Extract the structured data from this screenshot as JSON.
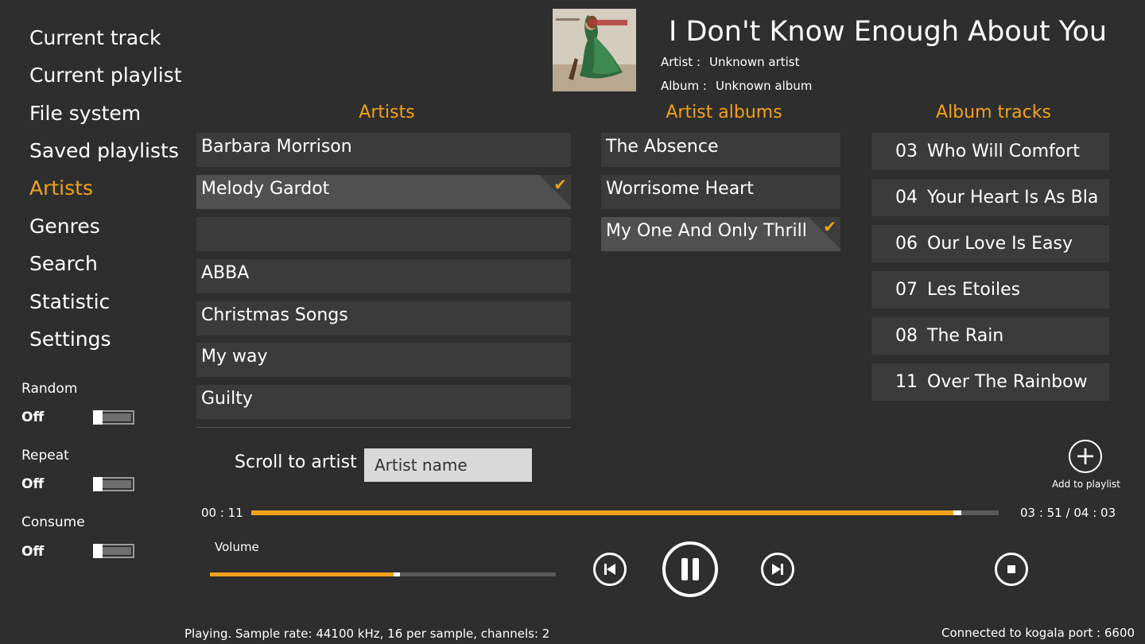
{
  "nav": {
    "items": [
      {
        "label": "Current track"
      },
      {
        "label": "Current playlist"
      },
      {
        "label": "File system"
      },
      {
        "label": "Saved playlists"
      },
      {
        "label": "Artists",
        "active": true
      },
      {
        "label": "Genres"
      },
      {
        "label": "Search"
      },
      {
        "label": "Statistic"
      },
      {
        "label": "Settings"
      }
    ]
  },
  "options": {
    "random": {
      "label": "Random",
      "value": "Off"
    },
    "repeat": {
      "label": "Repeat",
      "value": "Off"
    },
    "consume": {
      "label": "Consume",
      "value": "Off"
    }
  },
  "now_playing": {
    "title": "I Don't Know Enough About You",
    "artist_label": "Artist :",
    "artist_value": "Unknown artist",
    "album_label": "Album :",
    "album_value": "Unknown album"
  },
  "columns": {
    "artists_header": "Artists",
    "albums_header": "Artist albums",
    "tracks_header": "Album tracks"
  },
  "artists": [
    {
      "name": "Barbara Morrison"
    },
    {
      "name": "Melody Gardot",
      "selected": true
    },
    {
      "name": ""
    },
    {
      "name": "ABBA"
    },
    {
      "name": "Christmas Songs"
    },
    {
      "name": "My way"
    },
    {
      "name": "Guilty"
    }
  ],
  "albums": [
    {
      "name": "The Absence"
    },
    {
      "name": "Worrisome Heart"
    },
    {
      "name": "My One And Only Thrill",
      "selected": true
    }
  ],
  "tracks": [
    {
      "num": "03",
      "title": "Who Will Comfort"
    },
    {
      "num": "04",
      "title": "Your Heart Is As Bla"
    },
    {
      "num": "06",
      "title": "Our Love Is Easy"
    },
    {
      "num": "07",
      "title": "Les Etoiles"
    },
    {
      "num": "08",
      "title": "The Rain"
    },
    {
      "num": "11",
      "title": "Over The Rainbow"
    }
  ],
  "search": {
    "label": "Scroll to artist",
    "placeholder": "Artist name"
  },
  "add_to_playlist_label": "Add to playlist",
  "playback": {
    "elapsed": "00 : 11",
    "time_total": "03 : 51 / 04 : 03",
    "progress": 0.945,
    "volume_label": "Volume",
    "volume": 0.54
  },
  "status": {
    "left": "Playing.   Sample rate: 44100 kHz, 16 per sample, channels: 2",
    "right": "Connected to kogala port : 6600"
  },
  "colors": {
    "accent": "#f3a11b",
    "background": "#2e2e2e"
  }
}
